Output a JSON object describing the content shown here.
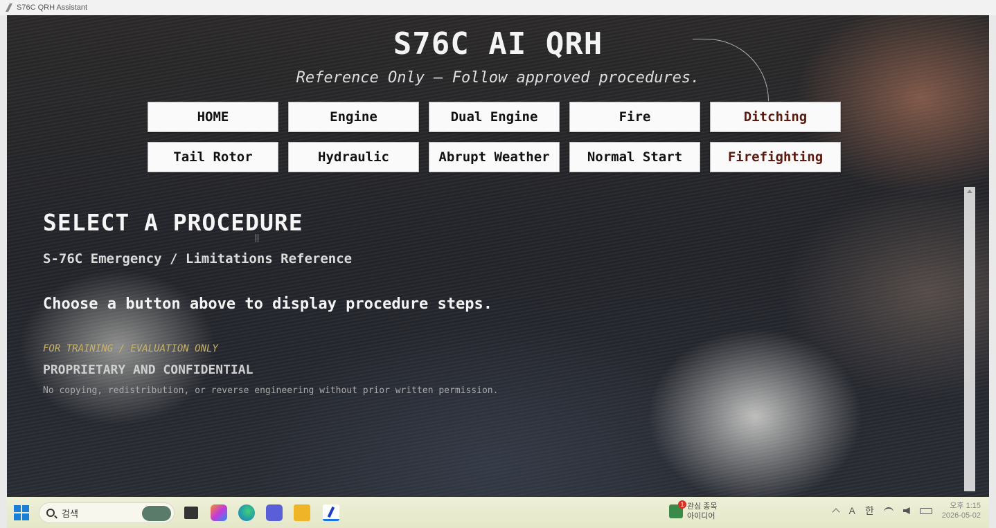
{
  "window": {
    "title": "S76C QRH Assistant"
  },
  "header": {
    "title": "S76C AI QRH",
    "subtitle": "Reference Only — Follow approved procedures."
  },
  "nav": {
    "row1": [
      "HOME",
      "Engine",
      "Dual Engine",
      "Fire",
      "Ditching"
    ],
    "row2": [
      "Tail Rotor",
      "Hydraulic",
      "Abrupt Weather",
      "Normal Start",
      "Firefighting"
    ]
  },
  "content": {
    "heading": "SELECT A PROCEDURE",
    "subheading": "S-76C Emergency / Limitations Reference",
    "instruction": "Choose a button above to display procedure steps.",
    "training_note": "FOR TRAINING / EVALUATION ONLY",
    "proprietary": "PROPRIETARY AND CONFIDENTIAL",
    "disclaimer": "No copying, redistribution, or reverse engineering without prior written permission."
  },
  "taskbar": {
    "search_placeholder": "검색",
    "widget_badge": "1",
    "widget_line1": "관심 종목",
    "widget_line2": "아이디어",
    "ime_a": "A",
    "ime_lang": "한",
    "clock_time": "오후 1:15",
    "clock_date": "2026-05-02"
  },
  "colors": {
    "background": "#26272d",
    "button_bg": "#fafafa",
    "accent_text": "#5a1a10",
    "training_note": "#c8b26c"
  }
}
